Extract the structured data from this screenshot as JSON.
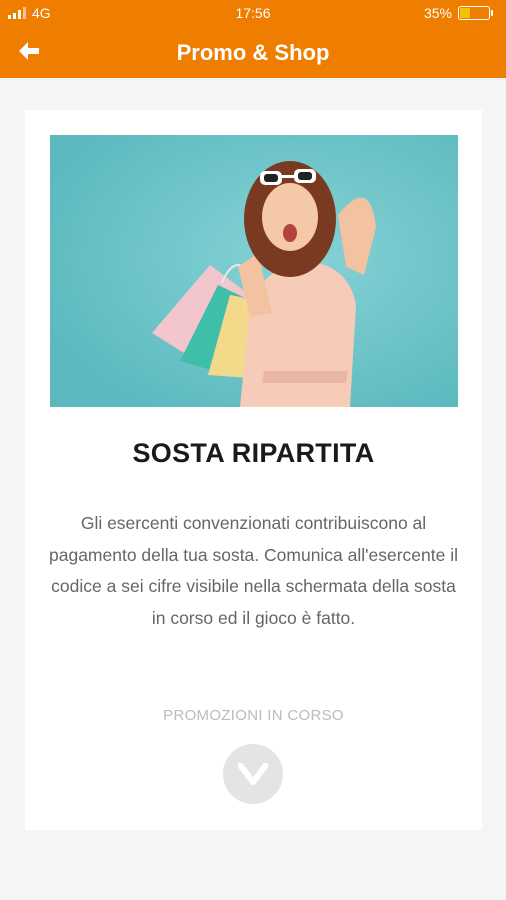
{
  "status_bar": {
    "network": "4G",
    "time": "17:56",
    "battery_percent": "35%",
    "battery_level": 0.35
  },
  "header": {
    "title": "Promo & Shop",
    "back_icon": "back-arrow-icon"
  },
  "card": {
    "image": "promo-hero-image",
    "title": "SOSTA RIPARTITA",
    "description": "Gli esercenti convenzionati contribuiscono al pagamento della tua sosta. Comunica all'esercente il codice a sei cifre visibile nella schermata della sosta in corso ed il gioco è fatto.",
    "promo_label": "PROMOZIONI IN CORSO",
    "expand_icon": "chevron-down-icon"
  },
  "colors": {
    "brand": "#ef7d00",
    "battery": "#f6c200",
    "hero_bg": "#6cc4c9"
  }
}
